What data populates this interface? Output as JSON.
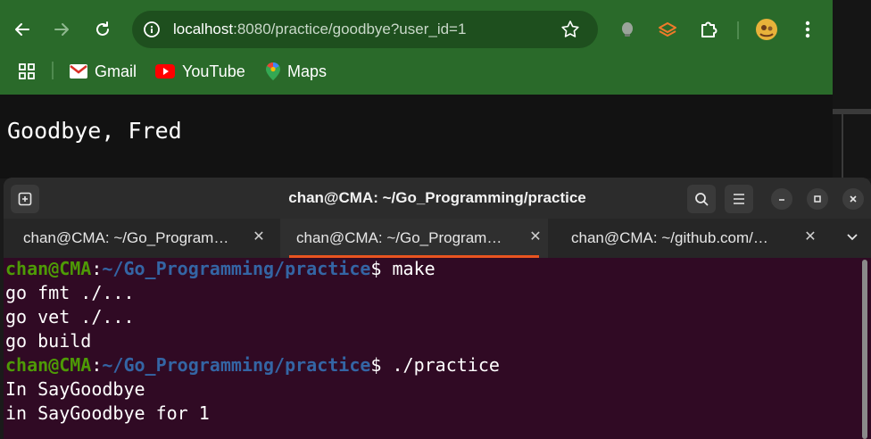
{
  "browser": {
    "url_host": "localhost",
    "url_rest": ":8080/practice/goodbye?user_id=1",
    "bookmarks": [
      {
        "label": "Gmail"
      },
      {
        "label": "YouTube"
      },
      {
        "label": "Maps"
      }
    ],
    "page_text": "Goodbye, Fred",
    "colors": {
      "toolbar": "#2a6a2a",
      "omnibox": "#1e4f1e",
      "content": "#121212"
    }
  },
  "terminal": {
    "title": "chan@CMA: ~/Go_Programming/practice",
    "tabs": [
      {
        "label": "chan@CMA: ~/Go_Program…",
        "active": false
      },
      {
        "label": "chan@CMA: ~/Go_Program…",
        "active": true
      },
      {
        "label": "chan@CMA: ~/github.com/…",
        "active": false
      }
    ],
    "lines": [
      {
        "type": "prompt",
        "user": "chan@CMA",
        "path": "~/Go_Programming/practice",
        "cmd": " make"
      },
      {
        "type": "output",
        "text": "go fmt ./..."
      },
      {
        "type": "output",
        "text": "go vet ./..."
      },
      {
        "type": "output",
        "text": "go build"
      },
      {
        "type": "prompt",
        "user": "chan@CMA",
        "path": "~/Go_Programming/practice",
        "cmd": " ./practice"
      },
      {
        "type": "output",
        "text": "In SayGoodbye"
      },
      {
        "type": "output",
        "text": "in SayGoodbye for 1"
      }
    ],
    "colors": {
      "background": "#300a24",
      "user": "#4e9a06",
      "path": "#3465a4",
      "tab_accent": "#e95420"
    }
  }
}
